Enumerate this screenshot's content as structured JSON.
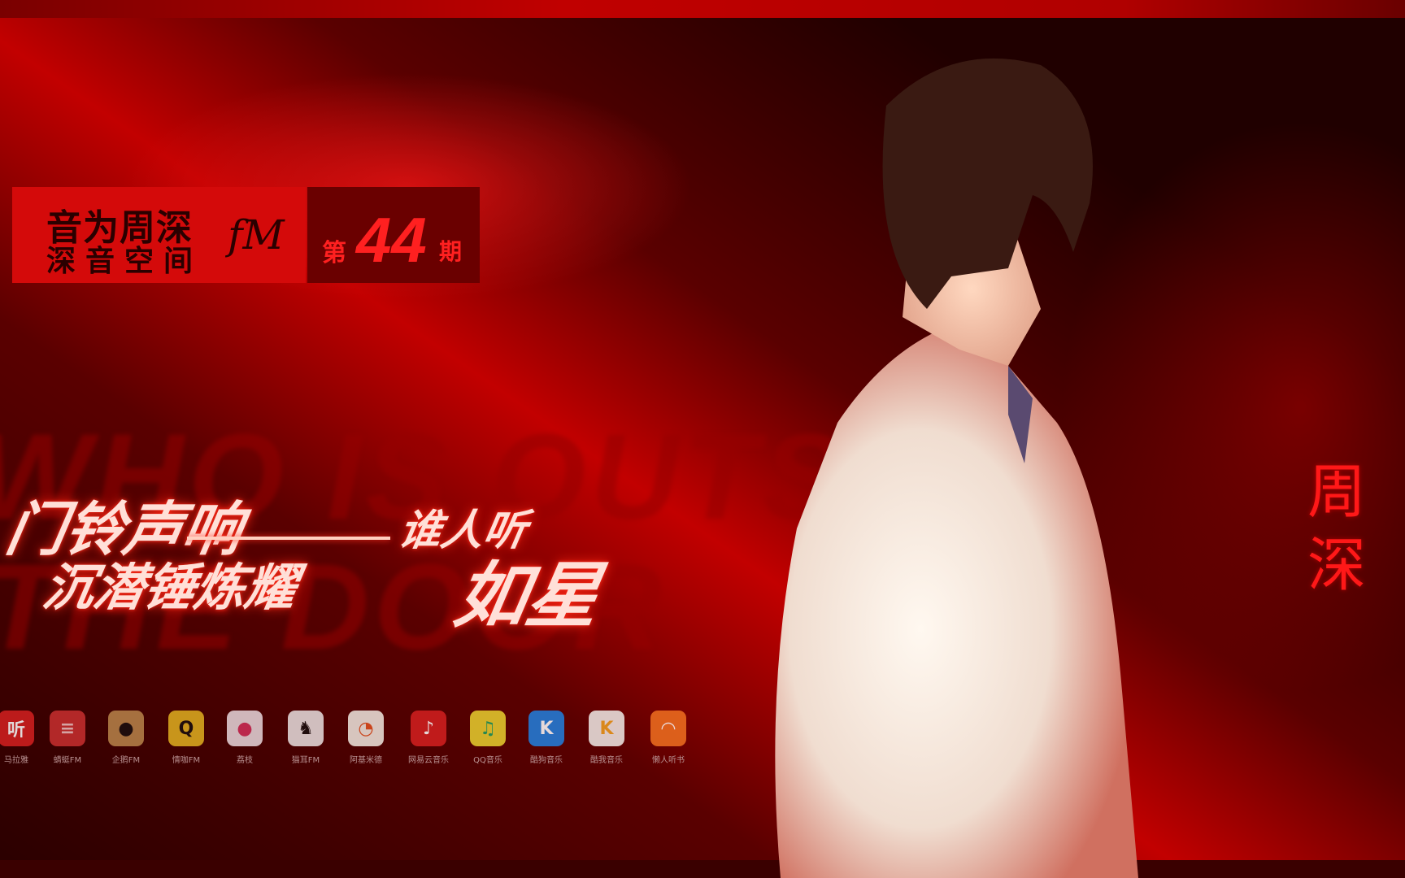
{
  "background_text": {
    "line1": "WHO IS OUTSIDE",
    "line2": "THE DOOR"
  },
  "logo": {
    "line1": "音为周深",
    "line2": "深音空间",
    "fm": "fM"
  },
  "issue": {
    "prefix": "第",
    "number": "44",
    "suffix": "期"
  },
  "headline": {
    "line1_main": "门铃声响",
    "line1_sub": "谁人听",
    "line2_main": "沉潜锤炼耀",
    "line2_big": "如星"
  },
  "artist_name": "周深",
  "colors": {
    "accent": "#d40a0a",
    "background": "#200000",
    "headline_glow": "#ff3020"
  },
  "platforms": [
    {
      "label": "马拉雅",
      "icon": "ximalaya-icon",
      "glyph": "听",
      "bg": "#d42020",
      "fg": "#fff"
    },
    {
      "label": "蜻蜓FM",
      "icon": "qingting-icon",
      "glyph": "≡",
      "bg": "#c83030",
      "fg": "#f0c0c0"
    },
    {
      "label": "企鹅FM",
      "icon": "penguin-icon",
      "glyph": "●",
      "bg": "#b8844a",
      "fg": "#1a1010"
    },
    {
      "label": "情咖FM",
      "icon": "qingka-icon",
      "glyph": "Q",
      "bg": "#e0b020",
      "fg": "#1a1010"
    },
    {
      "label": "荔枝",
      "icon": "lizhi-icon",
      "glyph": "●",
      "bg": "#e8d8dc",
      "fg": "#d0305a"
    },
    {
      "label": "猫耳FM",
      "icon": "maoer-icon",
      "glyph": "♞",
      "bg": "#e8e0e0",
      "fg": "#1a1010"
    },
    {
      "label": "阿基米德",
      "icon": "archimedes-icon",
      "glyph": "◔",
      "bg": "#f0e8e0",
      "fg": "#e05020"
    },
    {
      "label": "网易云音乐",
      "icon": "netease-icon",
      "glyph": "♪",
      "bg": "#d42020",
      "fg": "#fff"
    },
    {
      "label": "QQ音乐",
      "icon": "qqmusic-icon",
      "glyph": "♫",
      "bg": "#e8d030",
      "fg": "#20a060"
    },
    {
      "label": "酷狗音乐",
      "icon": "kugou-icon",
      "glyph": "K",
      "bg": "#2080e0",
      "fg": "#fff"
    },
    {
      "label": "酷我音乐",
      "icon": "kuwo-icon",
      "glyph": "K",
      "bg": "#f0ece8",
      "fg": "#f0a020"
    },
    {
      "label": "懒人听书",
      "icon": "lanren-icon",
      "glyph": "◠",
      "bg": "#f07020",
      "fg": "#fff"
    }
  ]
}
